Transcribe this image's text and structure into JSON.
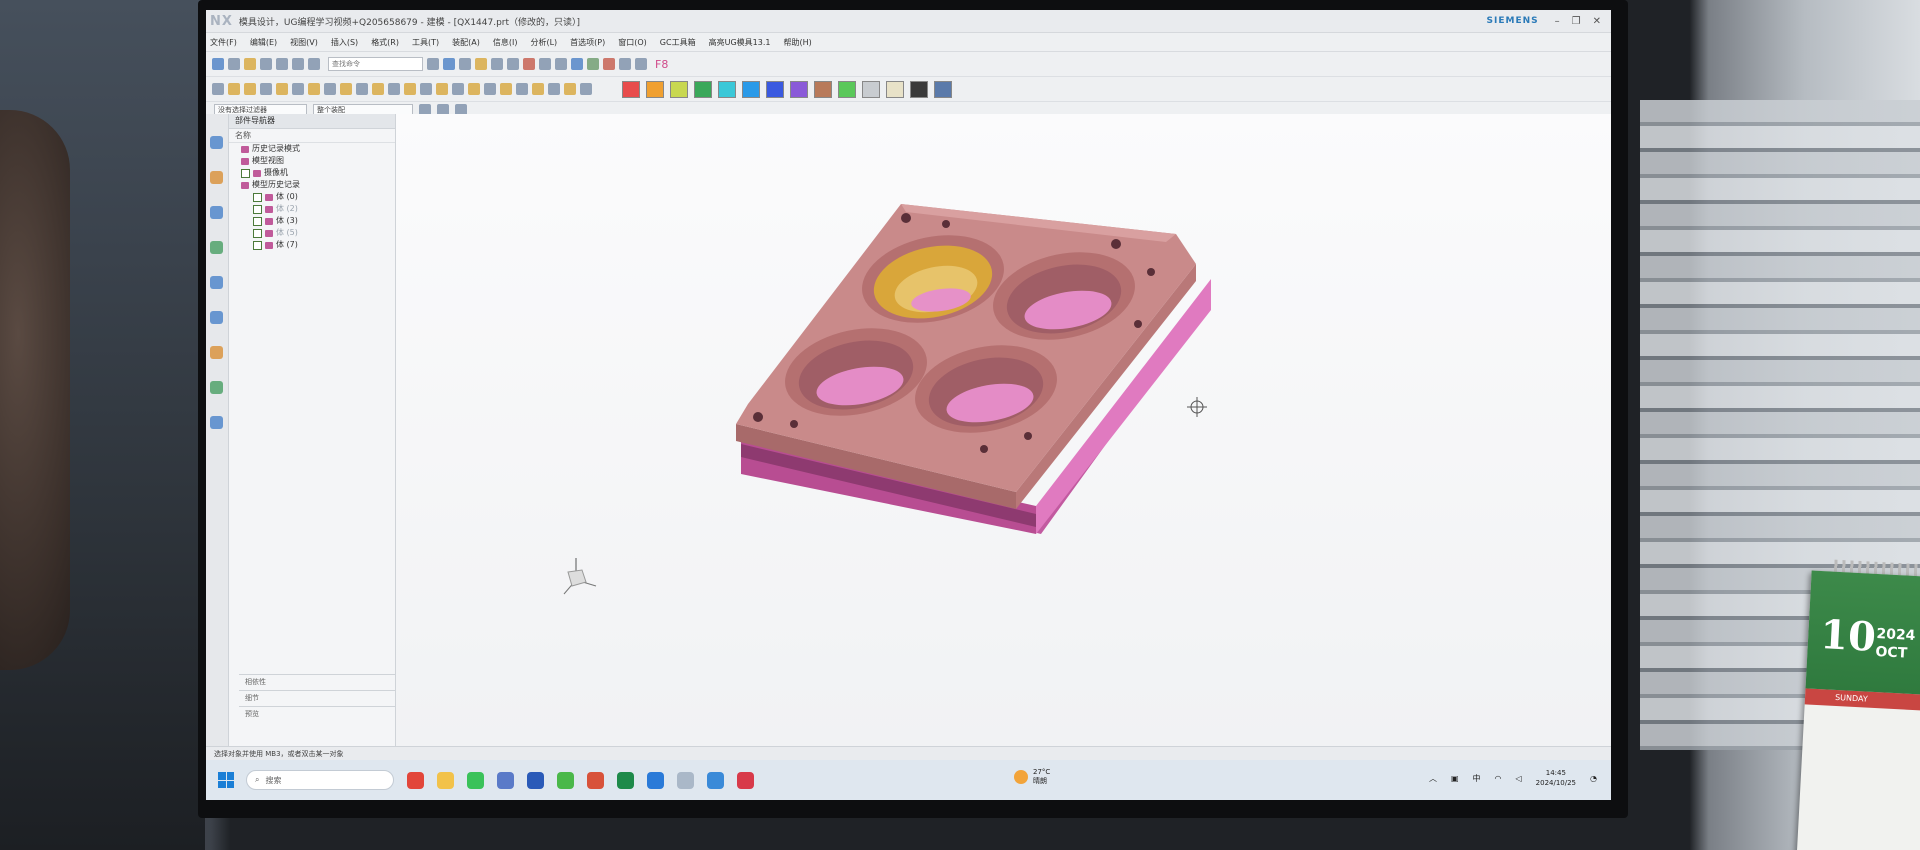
{
  "app": {
    "logo": "NX",
    "title": "模具设计，UG编程学习视频+Q205658679 - 建模 - [QX1447.prt（修改的，只读）]",
    "brand": "SIEMENS",
    "menu": [
      "文件(F)",
      "编辑(E)",
      "视图(V)",
      "插入(S)",
      "格式(R)",
      "工具(T)",
      "装配(A)",
      "信息(I)",
      "分析(L)",
      "首选项(P)",
      "窗口(O)",
      "GC工具箱",
      "高亮UG模具13.1",
      "帮助(H)"
    ],
    "search_placeholder": "查找命令",
    "filters": [
      "没有选择过滤器",
      "整个装配"
    ],
    "f8_label": "F8"
  },
  "toolbar_colors": [
    "#e84c4c",
    "#f0a030",
    "#c8d850",
    "#3aa85a",
    "#3ac8d8",
    "#2a9ae8",
    "#3a5ae0",
    "#8a5ad8",
    "#b87a5a",
    "#5ac85a",
    "#c8ccd0",
    "#e8e2c8",
    "#3a3a3a",
    "#5a7aaa"
  ],
  "navigator": {
    "title": "部件导航器",
    "column": "名称",
    "nodes": [
      {
        "label": "历史记录模式",
        "level": 1,
        "checked": false,
        "dim": false
      },
      {
        "label": "模型视图",
        "level": 1,
        "checked": false,
        "dim": false
      },
      {
        "label": "摄像机",
        "level": 1,
        "checked": true,
        "dim": false
      },
      {
        "label": "模型历史记录",
        "level": 1,
        "checked": false,
        "dim": false
      },
      {
        "label": "体 (0)",
        "level": 2,
        "checked": true,
        "dim": false
      },
      {
        "label": "体 (2)",
        "level": 2,
        "checked": true,
        "dim": true
      },
      {
        "label": "体 (3)",
        "level": 2,
        "checked": true,
        "dim": false
      },
      {
        "label": "体 (5)",
        "level": 2,
        "checked": true,
        "dim": true
      },
      {
        "label": "体 (7)",
        "level": 2,
        "checked": true,
        "dim": false
      }
    ],
    "panels": [
      "相依性",
      "细节",
      "预览"
    ]
  },
  "status": "选择对象并使用 MB3，或者双击某一对象",
  "taskbar": {
    "search_label": "搜索",
    "weather_temp": "27°C",
    "weather_desc": "晴朗",
    "ime": "中",
    "time": "14:45",
    "date": "2024/10/25"
  },
  "calendar": {
    "day": "10",
    "year": "2024",
    "month": "OCT",
    "weekday": "SUNDAY"
  },
  "model": {
    "plate_color": "#c98a8a",
    "base_color": "#d96ab0",
    "highlight_color": "#d9a63a"
  }
}
